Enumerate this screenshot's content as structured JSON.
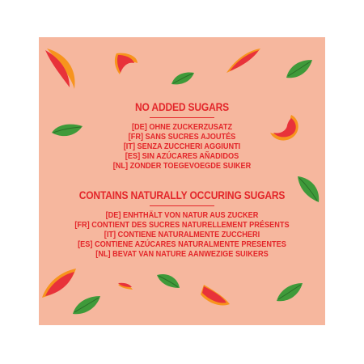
{
  "section1": {
    "heading": "NO ADDED SUGARS",
    "lines": [
      "[DE] OHNE ZUCKERZUSATZ",
      "[FR] SANS SUCRES AJOUTÉS",
      "[IT] SENZA ZUCCHERI AGGIUNTI",
      "[ES] SIN AZÚCARES AÑADIDOS",
      "[NL] ZONDER TOEGEVOEGDE SUIKER"
    ]
  },
  "section2": {
    "heading": "CONTAINS NATURALLY OCCURING SUGARS",
    "lines": [
      "[DE] ENHTHÄLT VON NATUR AUS ZUCKER",
      "[FR] CONTIENT DES SUCRES NATURELLEMENT PRÉSENTS",
      "[IT] CONTIENE NATURALMENTE ZUCCHERI",
      "[ES] CONTIENE AZÚCARES NATURALMENTE PRESENTES",
      "[NL] BEVAT VAN NATURE AANWEZIGE SUIKERS"
    ]
  },
  "colors": {
    "background": "#f6b79e",
    "text": "#e3262a",
    "fruit_red": "#e8323a",
    "fruit_orange": "#f7941d",
    "leaf_green": "#3f9a3a"
  },
  "icons": [
    "fruit-slice-icon",
    "leaf-icon"
  ]
}
